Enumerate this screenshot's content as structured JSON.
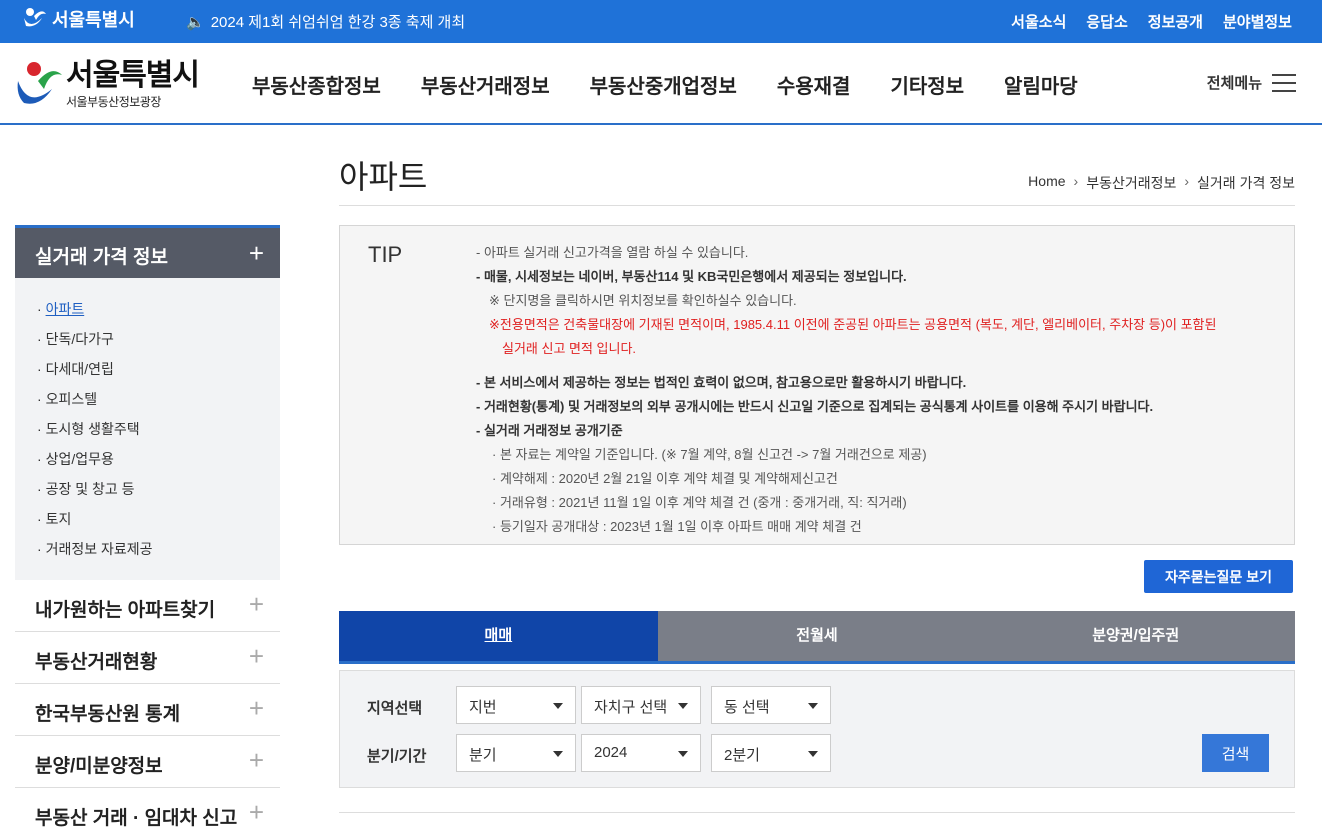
{
  "topbar": {
    "logo_text": "서울특별시",
    "notice": "2024 제1회 쉬엄쉬엄 한강 3종 축제 개최",
    "util_links": [
      "서울소식",
      "응답소",
      "정보공개",
      "분야별정보"
    ]
  },
  "header": {
    "brand_title": "서울특별시",
    "brand_sub": "서울부동산정보광장",
    "gnb": [
      "부동산종합정보",
      "부동산거래정보",
      "부동산중개업정보",
      "수용재결",
      "기타정보",
      "알림마당"
    ],
    "all_menu": "전체메뉴"
  },
  "sidebar": {
    "head": "실거래 가격 정보",
    "sub_items": [
      "아파트",
      "단독/다가구",
      "다세대/연립",
      "오피스텔",
      "도시형 생활주택",
      "상업/업무용",
      "공장 및 창고 등",
      "토지",
      "거래정보 자료제공"
    ],
    "menus": [
      "내가원하는 아파트찾기",
      "부동산거래현황",
      "한국부동산원 통계",
      "분양/미분양정보",
      "부동산 거래 · 임대차 신고"
    ]
  },
  "content": {
    "title": "아파트",
    "breadcrumb": [
      "Home",
      "부동산거래정보",
      "실거래 가격 정보"
    ],
    "tip_label": "TIP",
    "tip": {
      "l1": "- 아파트 실거래 신고가격을 열람 하실 수 있습니다.",
      "l2": "- 매물, 시세정보는 네이버, 부동산114 및 KB국민은행에서 제공되는 정보입니다.",
      "l3": "※ 단지명을 클릭하시면 위치정보를 확인하실수 있습니다.",
      "l4": "※전용면적은 건축물대장에 기재된 면적이며, 1985.4.11 이전에 준공된 아파트는 공용면적 (복도, 계단, 엘리베이터, 주차장 등)이 포함된",
      "l5": "실거래 신고 면적 입니다.",
      "l6": "- 본 서비스에서 제공하는 정보는 법적인 효력이 없으며, 참고용으로만 활용하시기 바랍니다.",
      "l7": "- 거래현황(통계) 및 거래정보의 외부 공개시에는 반드시 신고일 기준으로 집계되는 공식통계 사이트를 이용해 주시기 바랍니다.",
      "l8": "- 실거래 거래정보 공개기준",
      "l9": "· 본 자료는 계약일 기준입니다. (※ 7월 계약, 8월 신고건 -> 7월 거래건으로 제공)",
      "l10": "· 계약해제 : 2020년 2월 21일 이후 계약 체결 및 계약해제신고건",
      "l11": "· 거래유형 : 2021년 11월 1일 이후 계약 체결 건 (중개 : 중개거래, 직: 직거래)",
      "l12": "· 등기일자 공개대상 : 2023년 1월 1일 이후 아파트 매매 계약 체결 건"
    },
    "faq_button": "자주묻는질문 보기",
    "tabs": [
      "매매",
      "전월세",
      "분양권/입주권"
    ],
    "search": {
      "region_label": "지역선택",
      "period_label": "분기/기간",
      "region_selects": [
        "지번",
        "자치구 선택",
        "동 선택"
      ],
      "period_selects": [
        "분기",
        "2024",
        "2분기"
      ],
      "search_button": "검색"
    }
  }
}
